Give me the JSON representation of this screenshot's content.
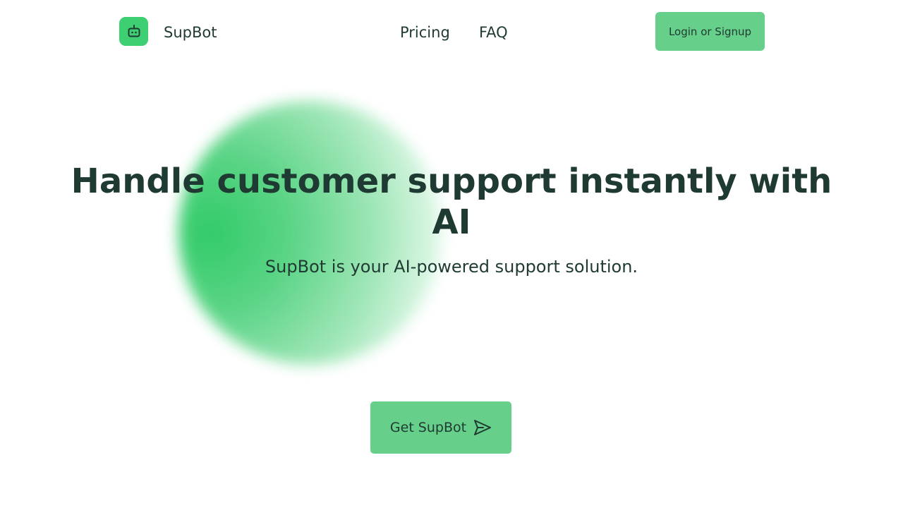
{
  "header": {
    "brand_name": "SupBot",
    "logo_icon": "robot-icon",
    "nav": [
      {
        "label": "Pricing"
      },
      {
        "label": "FAQ"
      }
    ],
    "login_label": "Login or Signup"
  },
  "hero": {
    "title": "Handle customer support instantly with AI",
    "subtitle": "SupBot is your AI-powered support solution.",
    "cta_label": "Get SupBot",
    "cta_icon": "send-icon"
  },
  "colors": {
    "accent": "#66cf8a",
    "logo_green": "#3ecf72",
    "text": "#1f3a32"
  }
}
